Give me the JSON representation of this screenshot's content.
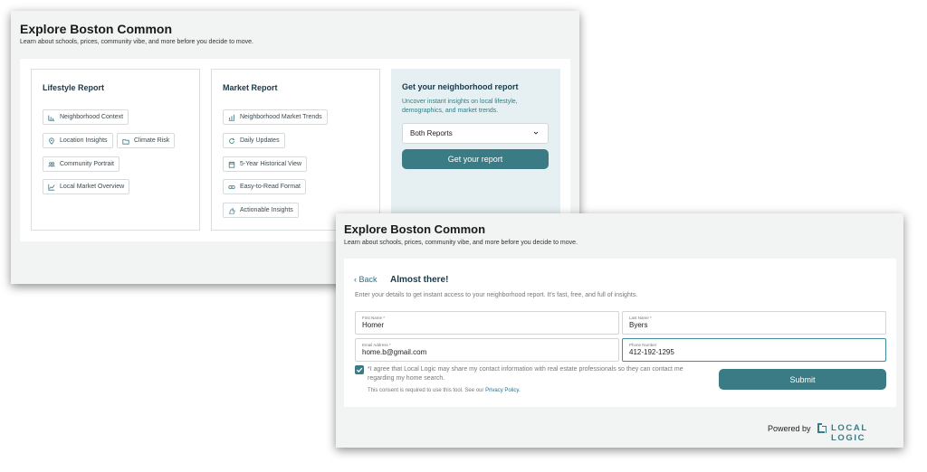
{
  "colors": {
    "accent": "#3a7b86",
    "cta_panel_bg": "#e6eff1",
    "link": "#2c6f8c"
  },
  "card1": {
    "title": "Explore Boston Common",
    "subtitle": "Learn about schools, prices, community vibe, and more before you decide to move.",
    "lifestyle": {
      "title": "Lifestyle Report",
      "chips": [
        {
          "label": "Neighborhood Context",
          "icon": "bar-chart-icon"
        },
        {
          "label": "Location Insights",
          "icon": "map-pin-icon"
        },
        {
          "label": "Climate Risk",
          "icon": "folder-icon"
        },
        {
          "label": "Community Portrait",
          "icon": "users-icon"
        },
        {
          "label": "Local Market Overview",
          "icon": "line-chart-icon"
        }
      ]
    },
    "market": {
      "title": "Market Report",
      "chips": [
        {
          "label": "Neighborhood Market Trends",
          "icon": "trend-chart-icon"
        },
        {
          "label": "Daily Updates",
          "icon": "refresh-icon"
        },
        {
          "label": "5-Year Historical View",
          "icon": "calendar-icon"
        },
        {
          "label": "Easy-to-Read Format",
          "icon": "eye-icon"
        },
        {
          "label": "Actionable Insights",
          "icon": "hand-icon"
        }
      ]
    },
    "cta": {
      "title": "Get your neighborhood report",
      "description": "Uncover instant insights on local lifestyle, demographics, and market trends.",
      "select_value": "Both Reports",
      "button_label": "Get your report"
    }
  },
  "card2": {
    "title": "Explore Boston Common",
    "subtitle": "Learn about schools, prices, community vibe, and more before you decide to move.",
    "back_label": "Back",
    "heading": "Almost there!",
    "intro": "Enter your details to get instant access to your neighborhood report. It's fast, free, and full of insights.",
    "fields": {
      "first_name": {
        "label": "First Name *",
        "value": "Homer"
      },
      "last_name": {
        "label": "Last Name *",
        "value": "Byers"
      },
      "email": {
        "label": "Email Address *",
        "value": "home.b@gmail.com"
      },
      "phone": {
        "label": "Phone Number",
        "value": "412-192-1295"
      }
    },
    "consent_line1": "*I agree that Local Logic may share my contact information with real estate professionals so they can contact me",
    "consent_line2": "regarding my home search.",
    "consent_note": "This consent is required to use this tool. See our ",
    "privacy_link": "Privacy Policy.",
    "submit_label": "Submit",
    "powered_by": "Powered by",
    "brand": "LOCAL LOGIC"
  }
}
